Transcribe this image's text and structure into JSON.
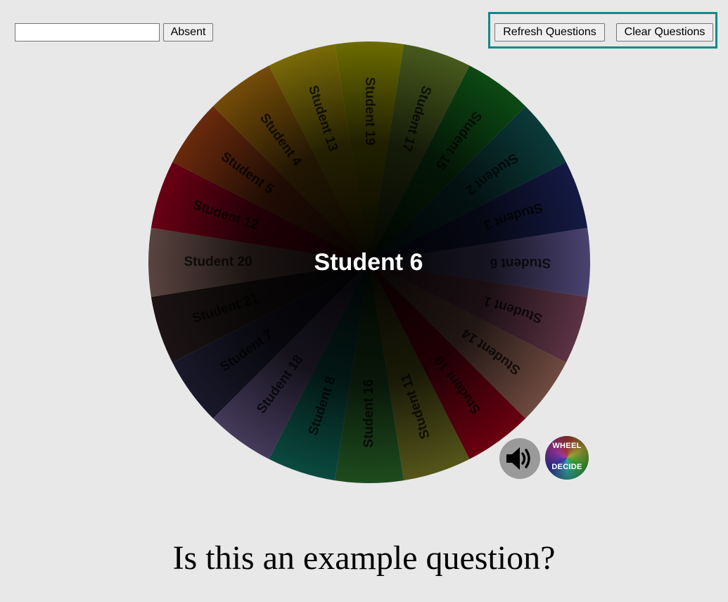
{
  "controls": {
    "absent_input_value": "",
    "absent_label": "Absent",
    "refresh_label": "Refresh Questions",
    "clear_label": "Clear Questions",
    "highlight_color": "#0f8a8a"
  },
  "wheel": {
    "winner": "Student 6",
    "segments": [
      {
        "label": "Student 6",
        "color": "#4a4370"
      },
      {
        "label": "Student 1",
        "color": "#5c3344"
      },
      {
        "label": "Student 14",
        "color": "#6e4a40"
      },
      {
        "label": "Student 10",
        "color": "#6b0010"
      },
      {
        "label": "Student 11",
        "color": "#55551a"
      },
      {
        "label": "Student 16",
        "color": "#1e4c1e"
      },
      {
        "label": "Student 8",
        "color": "#0a4a40"
      },
      {
        "label": "Student 18",
        "color": "#443a5a"
      },
      {
        "label": "Student 7",
        "color": "#18182a"
      },
      {
        "label": "Student 21",
        "color": "#1c1414"
      },
      {
        "label": "Student 20",
        "color": "#5a4440"
      },
      {
        "label": "Student 12",
        "color": "#6a0014"
      },
      {
        "label": "Student 5",
        "color": "#6a2a0c"
      },
      {
        "label": "Student 4",
        "color": "#744c08"
      },
      {
        "label": "Student 13",
        "color": "#7a6a08"
      },
      {
        "label": "Student 19",
        "color": "#6c6c00"
      },
      {
        "label": "Student 17",
        "color": "#475a1c"
      },
      {
        "label": "Student 15",
        "color": "#0c4a14"
      },
      {
        "label": "Student 2",
        "color": "#0c3a3a"
      },
      {
        "label": "Student 3",
        "color": "#141a44"
      }
    ]
  },
  "icons": {
    "sound": "speaker-icon",
    "logo": "wheel-decide-logo"
  },
  "logo": {
    "line1": "WHEEL",
    "line2": "DECIDE"
  },
  "question": "Is this an example question?"
}
